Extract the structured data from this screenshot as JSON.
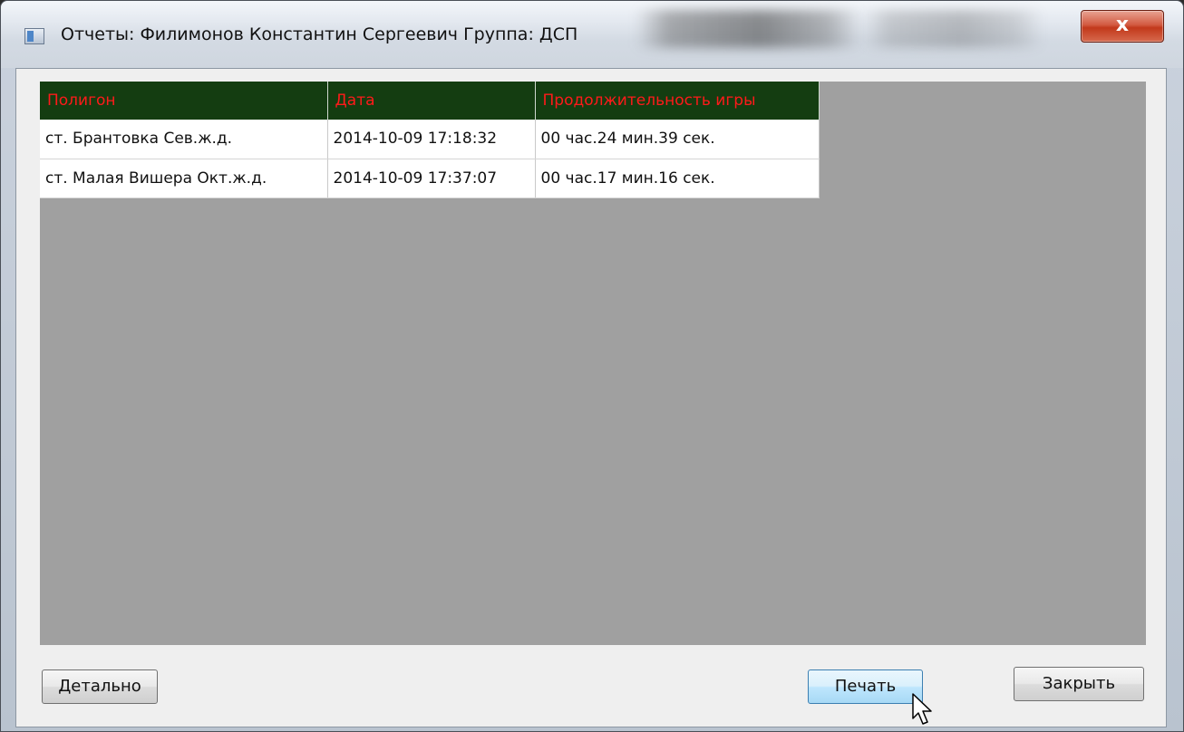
{
  "window": {
    "title": "Отчеты: Филимонов Константин Сергеевич Группа: ДСП",
    "close_glyph": "x"
  },
  "table": {
    "columns": [
      "Полигон",
      "Дата",
      "Продолжительность игры"
    ],
    "rows": [
      [
        "ст. Брантовка Сев.ж.д.",
        "2014-10-09 17:18:32",
        "00 час.24 мин.39 сек."
      ],
      [
        "ст. Малая Вишера Окт.ж.д.",
        "2014-10-09 17:37:07",
        "00 час.17 мин.16 сек."
      ]
    ],
    "header_bg": "#143d11",
    "header_text_color": "#ff1a1a"
  },
  "buttons": {
    "details": "Детально",
    "print": "Печать",
    "close": "Закрыть"
  },
  "icons": {
    "app": "window-app-icon",
    "cursor": "mouse-pointer-icon"
  }
}
